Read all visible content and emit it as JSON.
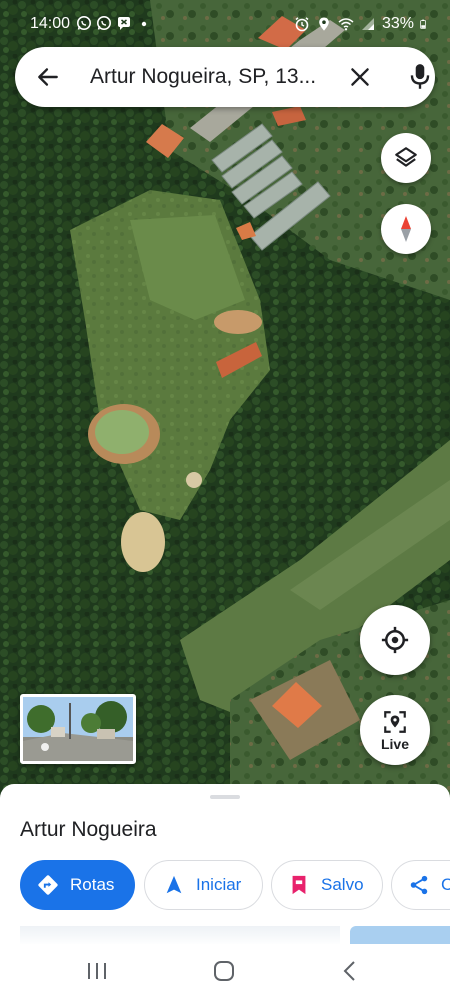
{
  "status_bar": {
    "time": "14:00",
    "battery": "33%",
    "left_icons": [
      "whatsapp-icon",
      "whatsapp-icon",
      "message-icon",
      "dot-icon"
    ],
    "right_icons": [
      "alarm-icon",
      "location-icon",
      "wifi-icon",
      "signal-icon",
      "battery-icon"
    ]
  },
  "search": {
    "query": "Artur Nogueira, SP, 13..."
  },
  "map_controls": {
    "layers_icon": "layers-icon",
    "compass_icon": "compass-icon",
    "location_icon": "my-location-icon",
    "live_label": "Live"
  },
  "place": {
    "title": "Artur Nogueira"
  },
  "actions": [
    {
      "label": "Rotas",
      "icon": "directions-icon",
      "primary": true
    },
    {
      "label": "Iniciar",
      "icon": "navigation-icon",
      "primary": false
    },
    {
      "label": "Salvo",
      "icon": "bookmark-icon",
      "primary": false
    },
    {
      "label": "C",
      "icon": "share-icon",
      "primary": false
    }
  ],
  "colors": {
    "accent": "#1a73e8",
    "saved": "#e8226c",
    "compass_red": "#ea4335"
  }
}
